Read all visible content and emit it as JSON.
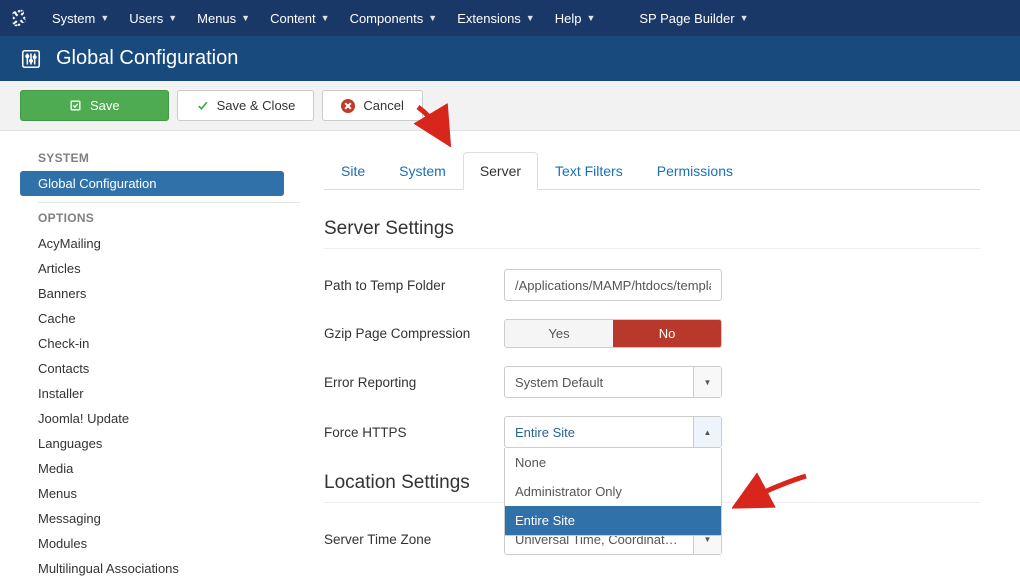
{
  "topnav": {
    "items": [
      {
        "label": "System"
      },
      {
        "label": "Users"
      },
      {
        "label": "Menus"
      },
      {
        "label": "Content"
      },
      {
        "label": "Components"
      },
      {
        "label": "Extensions"
      },
      {
        "label": "Help"
      },
      {
        "label": "SP Page Builder"
      }
    ]
  },
  "page_title": "Global Configuration",
  "toolbar": {
    "save": "Save",
    "save_close": "Save & Close",
    "cancel": "Cancel"
  },
  "sidebar": {
    "system_heading": "SYSTEM",
    "system_items": [
      "Global Configuration"
    ],
    "options_heading": "OPTIONS",
    "options_items": [
      "AcyMailing",
      "Articles",
      "Banners",
      "Cache",
      "Check-in",
      "Contacts",
      "Installer",
      "Joomla! Update",
      "Languages",
      "Media",
      "Menus",
      "Messaging",
      "Modules",
      "Multilingual Associations"
    ]
  },
  "tabs": [
    "Site",
    "System",
    "Server",
    "Text Filters",
    "Permissions"
  ],
  "active_tab": "Server",
  "sections": {
    "server_settings_title": "Server Settings",
    "location_settings_title": "Location Settings"
  },
  "fields": {
    "temp_path": {
      "label": "Path to Temp Folder",
      "value": "/Applications/MAMP/htdocs/templa"
    },
    "gzip": {
      "label": "Gzip Page Compression",
      "yes": "Yes",
      "no": "No",
      "value": "No"
    },
    "error_reporting": {
      "label": "Error Reporting",
      "value": "System Default"
    },
    "force_https": {
      "label": "Force HTTPS",
      "value": "Entire Site",
      "options": [
        "None",
        "Administrator Only",
        "Entire Site"
      ],
      "selected": "Entire Site"
    },
    "timezone": {
      "label": "Server Time Zone",
      "value": "Universal Time, Coordinated …"
    }
  }
}
